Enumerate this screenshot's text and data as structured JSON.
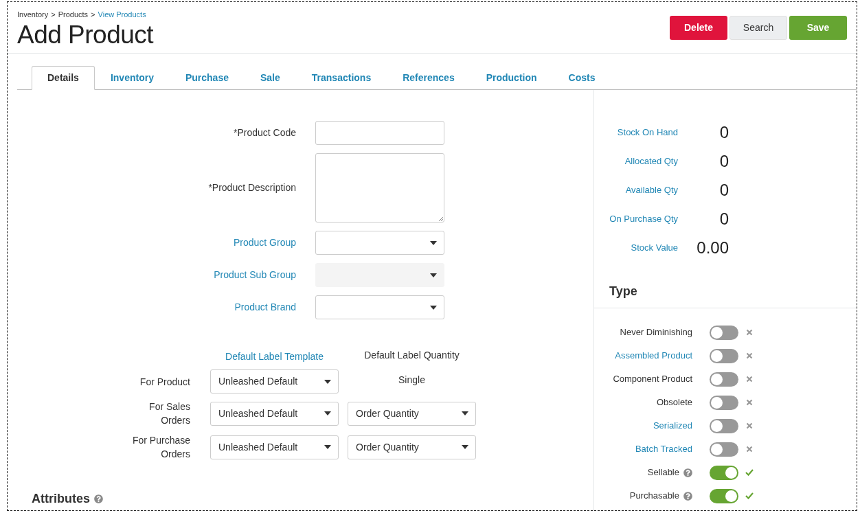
{
  "breadcrumb": [
    {
      "label": "Inventory",
      "link": false
    },
    {
      "label": "Products",
      "link": false
    },
    {
      "label": "View Products",
      "link": true
    }
  ],
  "breadcrumb_separator": ">",
  "title": "Add Product",
  "actions": [
    {
      "label": "Delete",
      "kind": "danger"
    },
    {
      "label": "Search",
      "kind": "neutral"
    },
    {
      "label": "Save",
      "kind": "primary"
    }
  ],
  "tabs": [
    {
      "label": "Details",
      "selected": true
    },
    {
      "label": "Inventory",
      "selected": false
    },
    {
      "label": "Purchase",
      "selected": false
    },
    {
      "label": "Sale",
      "selected": false
    },
    {
      "label": "Transactions",
      "selected": false
    },
    {
      "label": "References",
      "selected": false
    },
    {
      "label": "Production",
      "selected": false
    },
    {
      "label": "Costs",
      "selected": false
    }
  ],
  "fields": [
    {
      "label": "*Product Code",
      "kind": "text",
      "link": false,
      "disabled": false
    },
    {
      "label": "*Product Description",
      "kind": "textarea",
      "link": false,
      "disabled": false
    },
    {
      "label": "Product Group",
      "kind": "select",
      "link": true,
      "disabled": false
    },
    {
      "label": "Product Sub Group",
      "kind": "select",
      "link": true,
      "disabled": true
    },
    {
      "label": "Product Brand",
      "kind": "select",
      "link": true,
      "disabled": false
    }
  ],
  "labels": {
    "template_heading": "Default Label Template",
    "quantity_heading": "Default Label Quantity",
    "rows": [
      {
        "label": "For Product",
        "template": "Unleashed Default",
        "quantity": "Single",
        "kind": "text"
      },
      {
        "label": "For Sales Orders",
        "template": "Unleashed Default",
        "quantity": "Order Quantity",
        "kind": "select"
      },
      {
        "label": "For Purchase Orders",
        "template": "Unleashed Default",
        "quantity": "Order Quantity",
        "kind": "select"
      }
    ]
  },
  "attributes": {
    "title": "Attributes"
  },
  "stats": [
    {
      "label": "Stock On Hand",
      "value": "0"
    },
    {
      "label": "Allocated Qty",
      "value": "0"
    },
    {
      "label": "Available Qty",
      "value": "0"
    },
    {
      "label": "On Purchase Qty",
      "value": "0"
    },
    {
      "label": "Stock Value",
      "value": "0.00"
    }
  ],
  "type": {
    "title": "Type",
    "items": [
      {
        "label": "Never Diminishing",
        "link": false,
        "help": false,
        "on": false
      },
      {
        "label": "Assembled Product",
        "link": true,
        "help": false,
        "on": false
      },
      {
        "label": "Component Product",
        "link": false,
        "help": false,
        "on": false
      },
      {
        "label": "Obsolete",
        "link": false,
        "help": false,
        "on": false
      },
      {
        "label": "Serialized",
        "link": true,
        "help": false,
        "on": false
      },
      {
        "label": "Batch Tracked",
        "link": true,
        "help": false,
        "on": false
      },
      {
        "label": "Sellable",
        "link": false,
        "help": true,
        "on": true
      },
      {
        "label": "Purchasable",
        "link": false,
        "help": true,
        "on": true
      }
    ]
  }
}
